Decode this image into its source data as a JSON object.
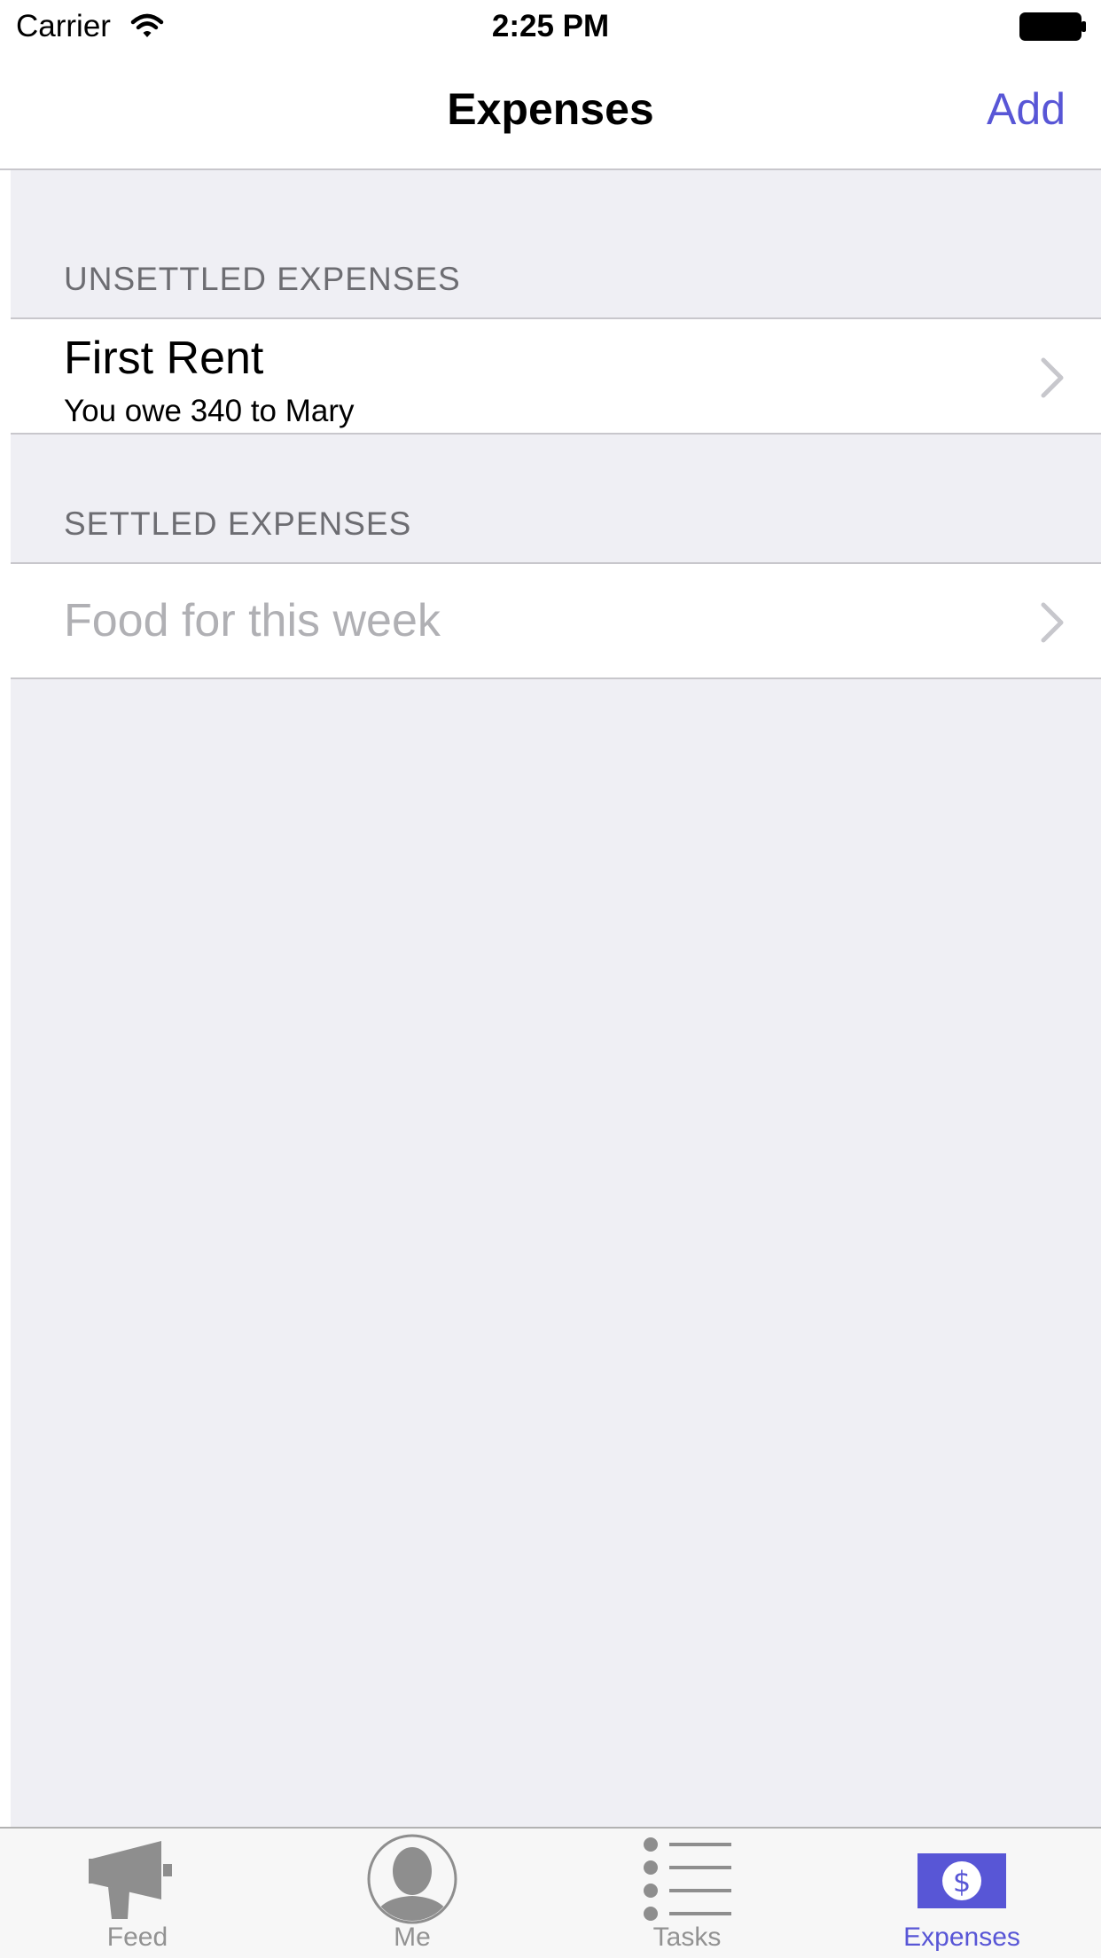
{
  "status_bar": {
    "carrier": "Carrier",
    "time": "2:25 PM",
    "icons": [
      "wifi-icon",
      "battery-icon"
    ]
  },
  "nav_bar": {
    "title": "Expenses",
    "add_label": "Add"
  },
  "sections": [
    {
      "header": "UNSETTLED EXPENSES",
      "rows": [
        {
          "title": "First Rent",
          "subtitle": "You owe 340 to Mary"
        }
      ]
    },
    {
      "header": "SETTLED EXPENSES",
      "rows": [
        {
          "title": "Food for this week"
        }
      ]
    }
  ],
  "tab_bar": {
    "tabs": [
      {
        "label": "Feed",
        "icon": "megaphone-icon",
        "selected": false
      },
      {
        "label": "Me",
        "icon": "person-icon",
        "selected": false
      },
      {
        "label": "Tasks",
        "icon": "list-icon",
        "selected": false
      },
      {
        "label": "Expenses",
        "icon": "dollar-icon",
        "selected": true
      }
    ]
  },
  "colors": {
    "accent": "#5856d6",
    "table_background": "#efeff4",
    "section_header_text": "#6d6d72",
    "settled_text": "#b0b0b4",
    "tab_inactive": "#929292"
  }
}
